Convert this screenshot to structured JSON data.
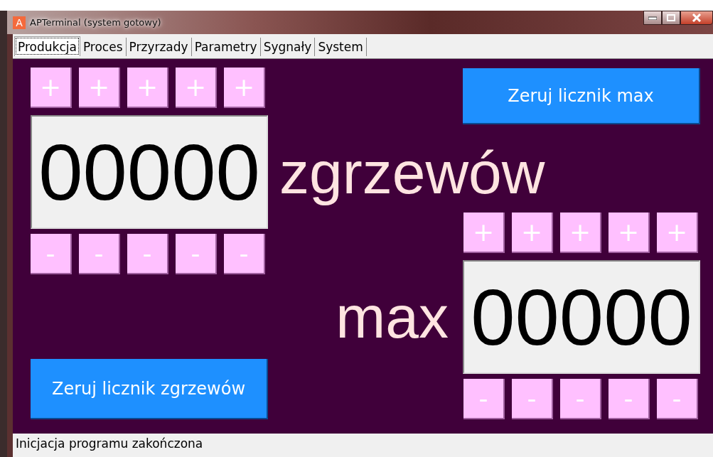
{
  "window": {
    "title": "APTerminal (system gotowy)",
    "app_icon_letter": "A"
  },
  "tabs": [
    {
      "label": "Produkcja",
      "selected": true
    },
    {
      "label": "Proces",
      "selected": false
    },
    {
      "label": "Przyrzady",
      "selected": false
    },
    {
      "label": "Parametry",
      "selected": false
    },
    {
      "label": "Sygnały",
      "selected": false
    },
    {
      "label": "System",
      "selected": false
    }
  ],
  "counter": {
    "increment_buttons": [
      "+",
      "+",
      "+",
      "+",
      "+"
    ],
    "value": "00000",
    "decrement_buttons": [
      "-",
      "-",
      "-",
      "-",
      "-"
    ],
    "unit_label": "zgrzewów",
    "reset_button": "Zeruj licznik zgrzewów"
  },
  "max_counter": {
    "reset_button": "Zeruj licznik max",
    "label": "max",
    "increment_buttons": [
      "+",
      "+",
      "+",
      "+",
      "+"
    ],
    "value": "00000",
    "decrement_buttons": [
      "-",
      "-",
      "-",
      "-",
      "-"
    ]
  },
  "status_bar": "Inicjacja programu zakończona"
}
